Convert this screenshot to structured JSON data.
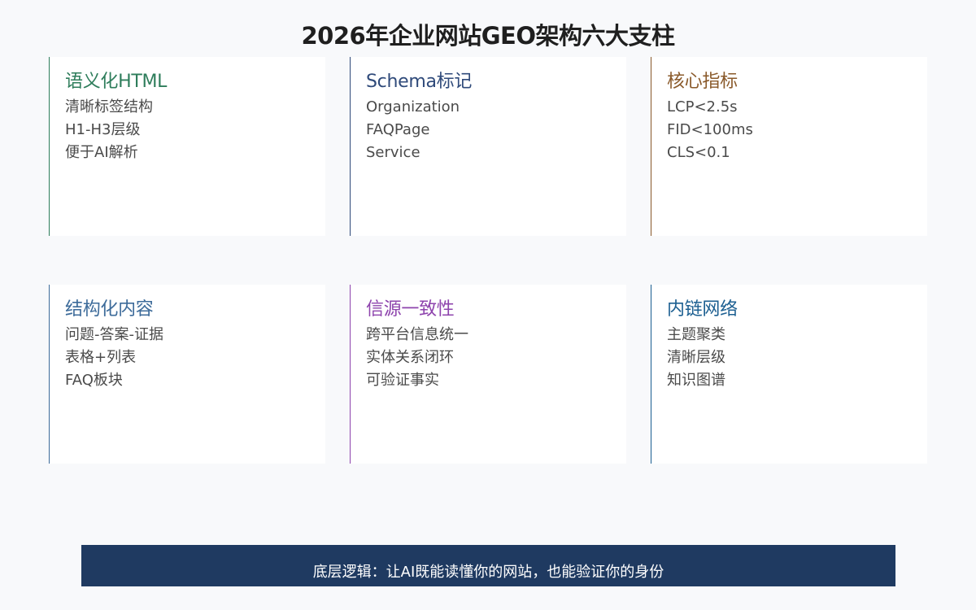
{
  "title": "2026年企业网站GEO架构六大支柱",
  "colors": {
    "background": "#f8f9fb",
    "card_background": "#ffffff",
    "banner_background": "#1f3a61",
    "banner_text": "#ffffff",
    "item_text": "#4a4a4a"
  },
  "pillars": [
    {
      "title": "语义化HTML",
      "color": "#2e7d5b",
      "items": [
        "清晰标签结构",
        "H1-H3层级",
        "便于AI解析"
      ]
    },
    {
      "title": "Schema标记",
      "color": "#2f4a7a",
      "items": [
        "Organization",
        "FAQPage",
        "Service"
      ]
    },
    {
      "title": "核心指标",
      "color": "#8a5a2b",
      "items": [
        "LCP<2.5s",
        "FID<100ms",
        "CLS<0.1"
      ]
    },
    {
      "title": "结构化内容",
      "color": "#3d6b9a",
      "items": [
        "问题-答案-证据",
        "表格+列表",
        "FAQ板块"
      ]
    },
    {
      "title": "信源一致性",
      "color": "#8e44ad",
      "items": [
        "跨平台信息统一",
        "实体关系闭环",
        "可验证事实"
      ]
    },
    {
      "title": "内链网络",
      "color": "#1c5f91",
      "items": [
        "主题聚类",
        "清晰层级",
        "知识图谱"
      ]
    }
  ],
  "banner": {
    "text": "底层逻辑：让AI既能读懂你的网站，也能验证你的身份"
  }
}
